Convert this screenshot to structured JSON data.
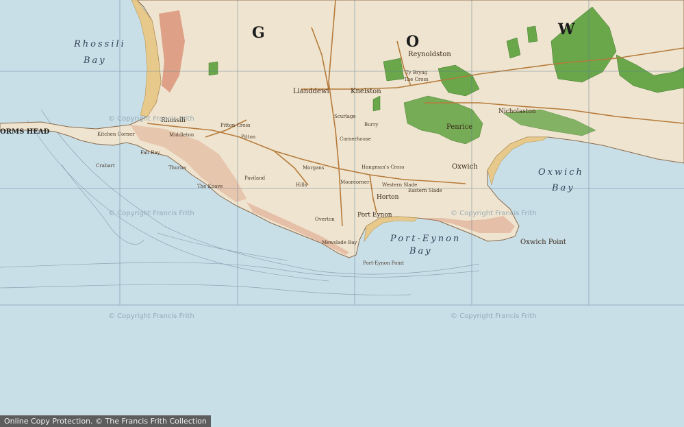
{
  "colors": {
    "sea": "#c9dfe8",
    "land": "#efe4cf",
    "sand": "#e8c98c",
    "wood": "#6aa64a",
    "cliff": "#d98b6f",
    "road": "#b57a3a",
    "grid": "#5b7c93"
  },
  "map": {
    "bays": {
      "rhossili_1": "Rhossili",
      "rhossili_2": "Bay",
      "oxwich_1": "Oxwich",
      "oxwich_2": "Bay",
      "porteynon_1": "Port-Eynon",
      "porteynon_2": "Bay"
    },
    "sheet_letters": {
      "g": "G",
      "o": "O",
      "w": "W"
    },
    "places": {
      "worms_head": "ORMS HEAD",
      "rhossili": "Rhossili",
      "middleton": "Middleton",
      "pitton": "Pitton",
      "pitton_cross": "Pitton Cross",
      "llanddewi": "Llanddewi",
      "knelston": "Knelston",
      "reynoldston": "Reynoldston",
      "penrice": "Penrice",
      "oxwich": "Oxwich",
      "nicholaston": "Nicholaston",
      "horton": "Horton",
      "port_eynon": "Port Eynon",
      "oxwich_point": "Oxwich Point",
      "port_eynon_point": "Port-Eynon Point",
      "moorcorner": "Moorcorner",
      "scurlage": "Scurlage",
      "overton": "Overton",
      "mewslade_bay": "Mewslade Bay",
      "hangmans_cross": "Hangman's Cross",
      "western_slade": "Western Slade",
      "eastern_slade": "Eastern Slade",
      "the_cross": "The Cross",
      "tyn_bryng": "Ty Bryng",
      "cornerhouse": "Cornerhouse",
      "kitchen_corner": "Kitchen Corner",
      "crabart": "Crabart",
      "paviland": "Paviland",
      "thurba": "Thurba",
      "fall_bay": "Fall Bay",
      "the_knave": "The Knave",
      "hills": "Hills",
      "morgans": "Morgans",
      "burry": "Burry"
    },
    "watermarks": [
      "© Copyright Francis Frith",
      "© Copyright Francis Frith",
      "© Copyright Francis Frith",
      "© Copyright Francis Frith",
      "© Copyright Francis Frith"
    ]
  },
  "footer": {
    "text": "Online Copy Protection. © The Francis Frith Collection"
  }
}
